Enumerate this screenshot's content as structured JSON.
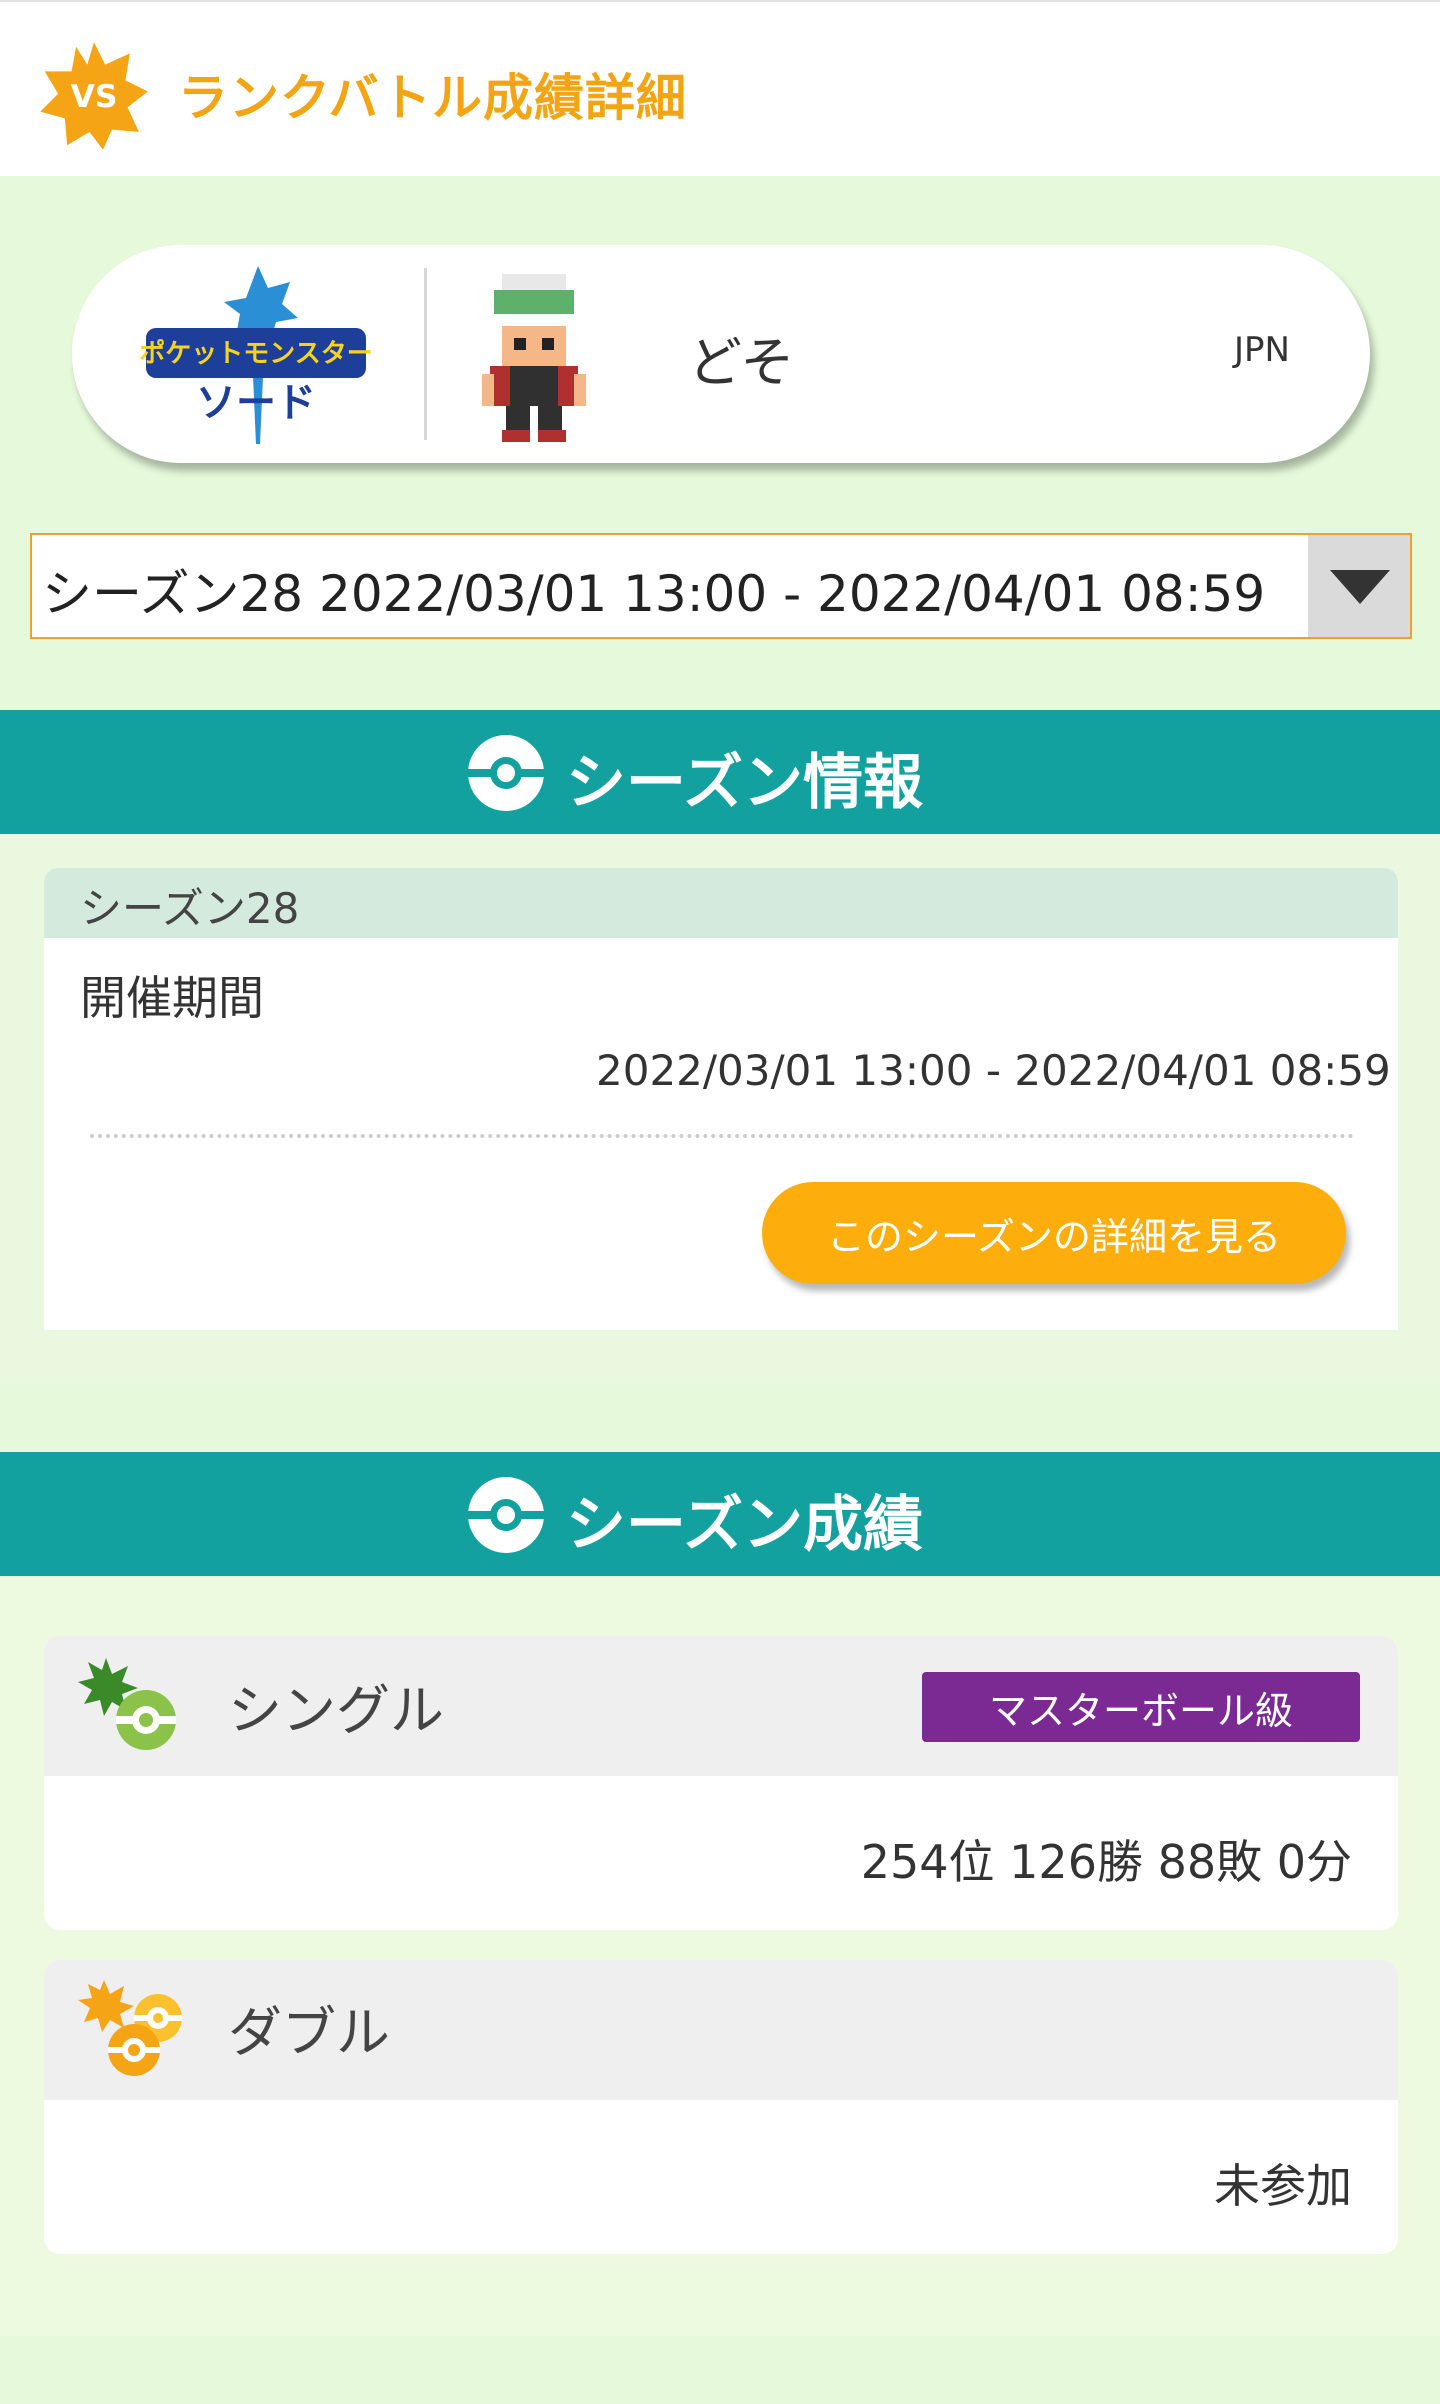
{
  "header": {
    "badge_text": "VS",
    "title": "ランクバトル成績詳細"
  },
  "player": {
    "game_logo_text_top": "ポケットモンスター",
    "game_logo_text_bottom": "ソード",
    "name": "どそ",
    "region": "JPN"
  },
  "season_select": {
    "selected": "シーズン28 2022/03/01 13:00 - 2022/04/01 08:59"
  },
  "season_info": {
    "section_title": "シーズン情報",
    "season_label": "シーズン28",
    "period_label": "開催期間",
    "period_value": "2022/03/01 13:00 - 2022/04/01 08:59",
    "detail_button": "このシーズンの詳細を見る"
  },
  "season_results": {
    "section_title": "シーズン成績",
    "single": {
      "label": "シングル",
      "rank_class": "マスターボール級",
      "record": "254位 126勝 88敗 0分"
    },
    "double": {
      "label": "ダブル",
      "record": "未参加"
    }
  },
  "colors": {
    "accent_orange": "#f2a413",
    "teal": "#13a19f",
    "button_orange": "#fdad0c",
    "master_purple": "#7a2a92",
    "page_bg": "#e6fadb"
  }
}
